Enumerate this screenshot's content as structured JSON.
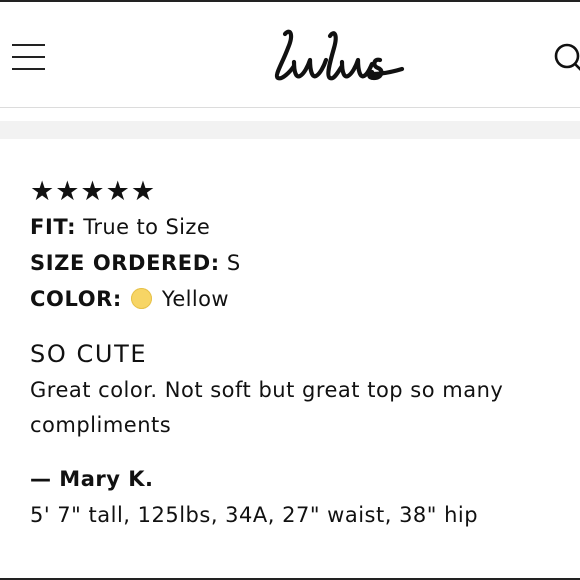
{
  "header": {
    "menu_icon": "hamburger-menu-icon",
    "logo_text": "Lulus",
    "search_icon": "search-icon"
  },
  "review": {
    "rating": 5,
    "rating_max": 5,
    "stars": "★★★★★",
    "fit_label": "FIT:",
    "fit_value": "True to Size",
    "size_label": "SIZE ORDERED:",
    "size_value": "S",
    "color_label": "COLOR:",
    "color_value": "Yellow",
    "color_swatch": "#f7d565",
    "title": "SO CUTE",
    "body": "Great color. Not soft but great top so many compliments",
    "author": "— Mary K.",
    "measurements": "5' 7\" tall, 125lbs, 34A, 27\" waist, 38\" hip"
  }
}
